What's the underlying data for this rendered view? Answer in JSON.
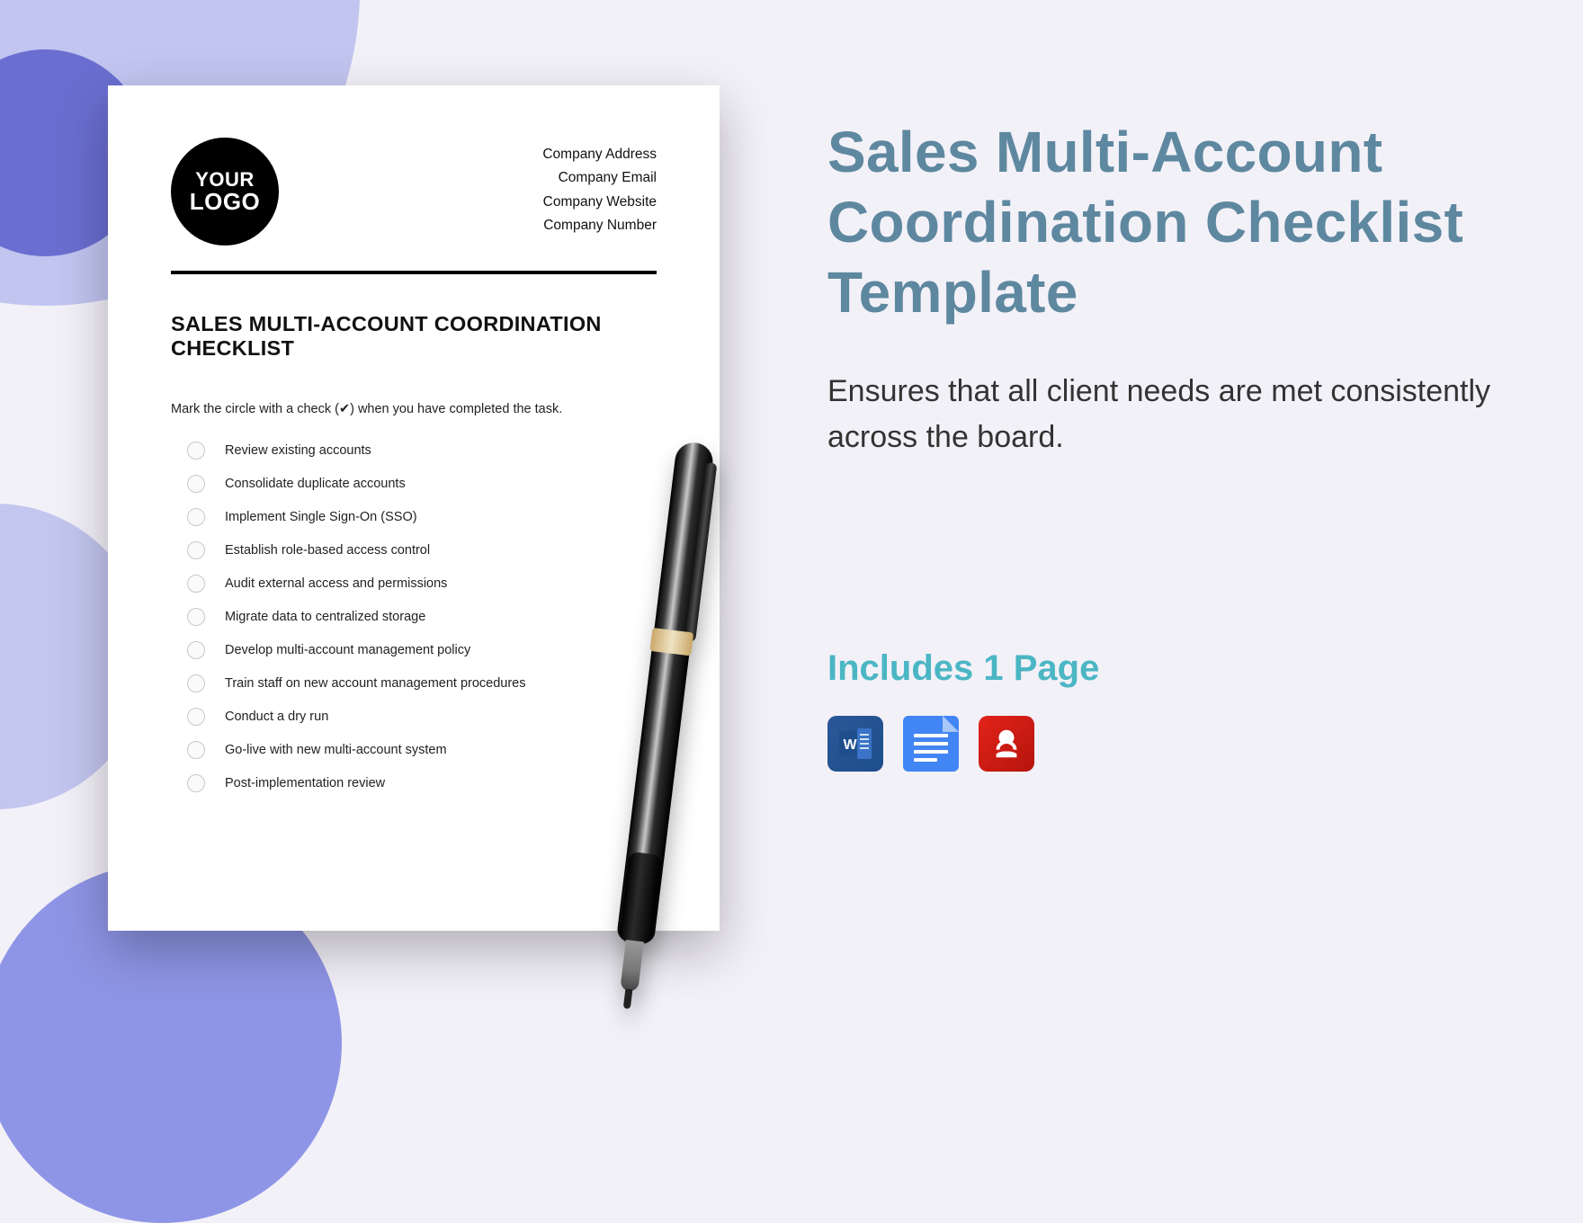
{
  "colors": {
    "accent": "#5e88a0",
    "teal": "#4bb6c4",
    "lilac": "#c1c5f0",
    "violet": "#6a6ed0",
    "purple2": "#8f95e6"
  },
  "document": {
    "logo_line1": "YOUR",
    "logo_line2": "LOGO",
    "meta": {
      "address": "Company Address",
      "email": "Company Email",
      "website": "Company Website",
      "number": "Company Number"
    },
    "title": "SALES MULTI-ACCOUNT COORDINATION CHECKLIST",
    "instruction": "Mark the circle with a check (✔) when you have completed the task.",
    "items": [
      "Review existing accounts",
      "Consolidate duplicate accounts",
      "Implement Single Sign-On (SSO)",
      "Establish role-based access control",
      "Audit external access and permissions",
      "Migrate data to centralized storage",
      "Develop multi-account management policy",
      "Train staff on new account management procedures",
      "Conduct a dry run",
      "Go-live with new multi-account system",
      "Post-implementation review"
    ]
  },
  "promo": {
    "title": "Sales Multi-Account Coordination Checklist Template",
    "description": "Ensures that all client needs are met consistently across the board.",
    "includes": "Includes 1 Page",
    "formats": [
      "word",
      "google-docs",
      "pdf"
    ]
  }
}
